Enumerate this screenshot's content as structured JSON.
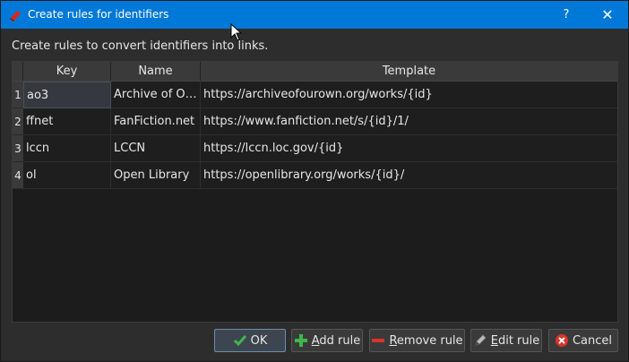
{
  "window": {
    "title": "Create rules for identifiers",
    "help_label": "?",
    "close_label": "✕",
    "icon": "red-book-icon"
  },
  "instructions": "Create rules to convert identifiers into links.",
  "table": {
    "columns": [
      "Key",
      "Name",
      "Template"
    ],
    "rows": [
      {
        "num": "1",
        "key": "ao3",
        "name": "Archive of O…",
        "template": "https://archiveofourown.org/works/{id}"
      },
      {
        "num": "2",
        "key": "ffnet",
        "name": "FanFiction.net",
        "template": "https://www.fanfiction.net/s/{id}/1/"
      },
      {
        "num": "3",
        "key": "lccn",
        "name": "LCCN",
        "template": "https://lccn.loc.gov/{id}"
      },
      {
        "num": "4",
        "key": "ol",
        "name": "Open Library",
        "template": "https://openlibrary.org/works/{id}/"
      }
    ]
  },
  "buttons": {
    "ok": "OK",
    "add": "Add rule",
    "remove": "Remove rule",
    "edit": "Edit rule",
    "cancel": "Cancel"
  },
  "colors": {
    "titlebar": "#0078d7",
    "ok_check": "#3cb84a",
    "add_plus": "#3cb84a",
    "remove_minus": "#d9342b",
    "cancel_x": "#d9342b"
  }
}
